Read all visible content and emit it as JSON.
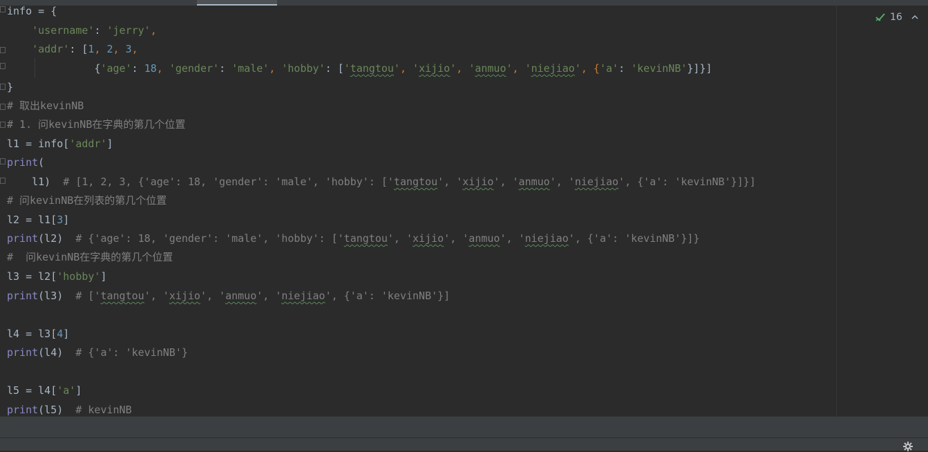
{
  "editor": {
    "lines": {
      "l01_a": "info = {",
      "l02_key": "'username'",
      "l02_sep": ": ",
      "l02_val": "'jerry'",
      "l02_comma": ",",
      "l03_key": "'addr'",
      "l03_sep": ": [",
      "l03_n1": "1",
      "l03_c1": ", ",
      "l03_n2": "2",
      "l03_c2": ", ",
      "l03_n3": "3",
      "l03_c3": ",",
      "l04_a": "{",
      "l04_k1": "'age'",
      "l04_b": ": ",
      "l04_n1": "18",
      "l04_c": ", ",
      "l04_k2": "'gender'",
      "l04_d": ": ",
      "l04_v2": "'male'",
      "l04_e": ", ",
      "l04_k3": "'hobby'",
      "l04_f": ": [",
      "l04_h1a": "'",
      "l04_h1": "tangtou",
      "l04_h1b": "'",
      "l04_g1": ", ",
      "l04_h2a": "'",
      "l04_h2": "xijio",
      "l04_h2b": "'",
      "l04_g2": ", ",
      "l04_h3a": "'",
      "l04_h3": "anmuo",
      "l04_h3b": "'",
      "l04_g3": ", ",
      "l04_h4a": "'",
      "l04_h4": "niejiao",
      "l04_h4b": "'",
      "l04_g4": ", {",
      "l04_k4": "'a'",
      "l04_g5": ": ",
      "l04_v4": "'kevinNB'",
      "l04_end": "}]}]",
      "l05": "}",
      "l06": "# 取出kevinNB",
      "l07": "# 1. 问kevinNB在字典的第几个位置",
      "l08_a": "l1 = info[",
      "l08_s": "'addr'",
      "l08_b": "]",
      "l09_f": "print",
      "l09_b": "(",
      "l10_a": "    l1)  ",
      "l10_c1": "# [1, 2, 3, {'age': 18, 'gender': 'male', 'hobby': ['",
      "l10_u1": "tangtou",
      "l10_c2": "', '",
      "l10_u2": "xijio",
      "l10_c3": "', '",
      "l10_u3": "anmuo",
      "l10_c4": "', '",
      "l10_u4": "niejiao",
      "l10_c5": "', {'a': 'kevinNB'}]}]",
      "l11": "# 问kevinNB在列表的第几个位置",
      "l12_a": "l2 = l1[",
      "l12_n": "3",
      "l12_b": "]",
      "l13_f": "print",
      "l13_a": "(l2)  ",
      "l13_c1": "# {'age': 18, 'gender': 'male', 'hobby': ['",
      "l13_u1": "tangtou",
      "l13_c2": "', '",
      "l13_u2": "xijio",
      "l13_c3": "', '",
      "l13_u3": "anmuo",
      "l13_c4": "', '",
      "l13_u4": "niejiao",
      "l13_c5": "', {'a': 'kevinNB'}]}",
      "l14": "#  问kevinNB在字典的第几个位置",
      "l15_a": "l3 = l2[",
      "l15_s": "'hobby'",
      "l15_b": "]",
      "l16_f": "print",
      "l16_a": "(l3)  ",
      "l16_c1": "# ['",
      "l16_u1": "tangtou",
      "l16_c2": "', '",
      "l16_u2": "xijio",
      "l16_c3": "', '",
      "l16_u3": "anmuo",
      "l16_c4": "', '",
      "l16_u4": "niejiao",
      "l16_c5": "', {'a': 'kevinNB'}]",
      "l18_a": "l4 = l3[",
      "l18_n": "4",
      "l18_b": "]",
      "l19_f": "print",
      "l19_a": "(l4)  ",
      "l19_c": "# {'a': 'kevinNB'}",
      "l21_a": "l5 = l4[",
      "l21_s": "'a'",
      "l21_b": "]",
      "l22_f": "print",
      "l22_a": "(l5)  ",
      "l22_c": "# kevinNB"
    }
  },
  "inspection": {
    "count": "16",
    "icon": "check-icon"
  },
  "colors": {
    "background": "#2b2b2b",
    "string": "#6a8759",
    "number": "#6897bb",
    "keyword": "#cc7832",
    "builtin": "#8888c6",
    "comment": "#808080",
    "text": "#a9b7c6",
    "check": "#59a869"
  }
}
